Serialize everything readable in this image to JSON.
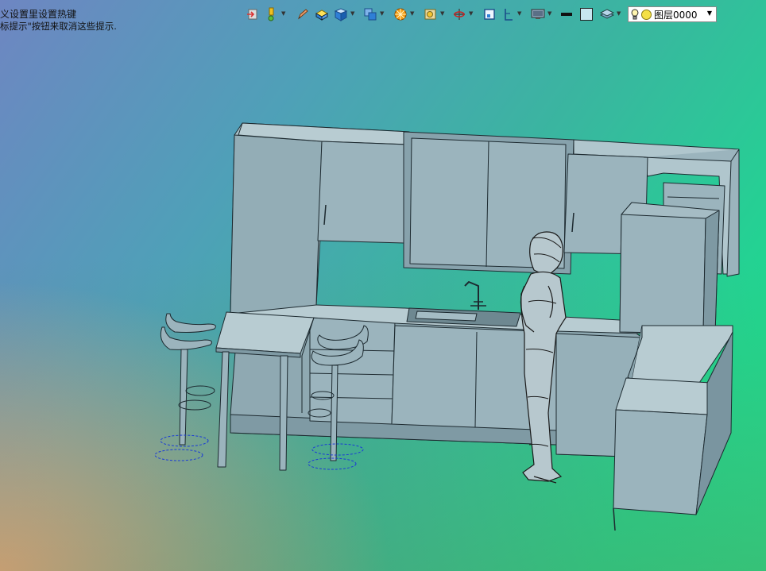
{
  "hints": {
    "line1": "义设置里设置热键",
    "line2": "标提示\"按钮来取消这些提示."
  },
  "toolbar": {
    "buttons": [
      {
        "icon": "exit-icon",
        "has_dropdown": false
      },
      {
        "icon": "point-tool-icon",
        "has_dropdown": true
      },
      {
        "icon": "pencil-icon",
        "has_dropdown": false
      },
      {
        "icon": "block-icon",
        "has_dropdown": false
      },
      {
        "icon": "cube-icon",
        "has_dropdown": true
      },
      {
        "icon": "view-cube-icon",
        "has_dropdown": true
      },
      {
        "icon": "render-sphere-icon",
        "has_dropdown": true
      },
      {
        "icon": "camera-icon",
        "has_dropdown": true
      },
      {
        "icon": "orbit-icon",
        "has_dropdown": true
      },
      {
        "icon": "frame-icon",
        "has_dropdown": false
      },
      {
        "icon": "section-icon",
        "has_dropdown": true
      },
      {
        "icon": "display-monitor-icon",
        "has_dropdown": true
      },
      {
        "icon": "line-weight-icon",
        "has_dropdown": false
      },
      {
        "icon": "color-swatch-icon",
        "has_dropdown": false
      },
      {
        "icon": "layers-icon",
        "has_dropdown": true
      }
    ],
    "colors": {
      "icon_blue": "#2f7fd6",
      "icon_yellow": "#f0c020",
      "icon_orange": "#f39c12"
    }
  },
  "layer": {
    "name": "图层0000",
    "bulb_icon": "lightbulb-icon",
    "color_icon": "layer-color-icon"
  },
  "scene": {
    "object_fill": "#9bb4bd",
    "object_stroke": "#1d2a30",
    "selection_color": "#1a3bd6"
  }
}
